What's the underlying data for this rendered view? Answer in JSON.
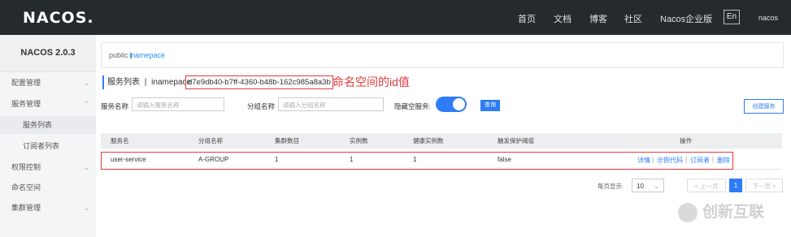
{
  "header": {
    "logo": "NACOS.",
    "nav": [
      "首页",
      "文档",
      "博客",
      "社区",
      "Nacos企业版"
    ],
    "lang": "En",
    "user": "nacos"
  },
  "sidebar": {
    "version": "NACOS 2.0.3",
    "items": [
      {
        "label": "配置管理",
        "chevron": "⌄"
      },
      {
        "label": "服务管理",
        "chevron": "⌃"
      },
      {
        "label": "服务列表"
      },
      {
        "label": "订阅者列表"
      },
      {
        "label": "权限控制",
        "chevron": "⌄"
      },
      {
        "label": "命名空间"
      },
      {
        "label": "集群管理",
        "chevron": "⌄"
      }
    ]
  },
  "breadcrumb": {
    "namespace": "public",
    "sep": "|",
    "link": "inamepace"
  },
  "title": {
    "label": "服务列表",
    "sep": "|",
    "ns_name": "inamepace",
    "ns_id": "d7e9db40-b7ff-4360-b48b-162c985a8a3b"
  },
  "annotation": "命名空间的id值",
  "filters": {
    "service_label": "服务名称",
    "service_placeholder": "请输入服务名称",
    "group_label": "分组名称",
    "group_placeholder": "请输入分组名称",
    "hide_empty_label": "隐藏空服务:",
    "query_button": "查询",
    "create_button": "创建服务"
  },
  "table": {
    "headers": [
      "服务名",
      "分组名称",
      "集群数目",
      "实例数",
      "健康实例数",
      "触发保护阈值",
      "操作"
    ],
    "rows": [
      {
        "service": "user-service",
        "group": "A-GROUP",
        "clusters": "1",
        "instances": "1",
        "healthy": "1",
        "protect": "false",
        "actions": [
          "详情",
          "示例代码",
          "订阅者",
          "删除"
        ]
      }
    ],
    "action_sep": "|"
  },
  "pagination": {
    "page_size_label": "每页显示:",
    "page_size": "10",
    "prev": "< 上一页",
    "current": "1",
    "next": "下一页 >"
  },
  "watermark": "创新互联",
  "colors": {
    "accent": "#2e7cf6",
    "annotation": "#e53a3a",
    "topbar": "#252a2f"
  }
}
